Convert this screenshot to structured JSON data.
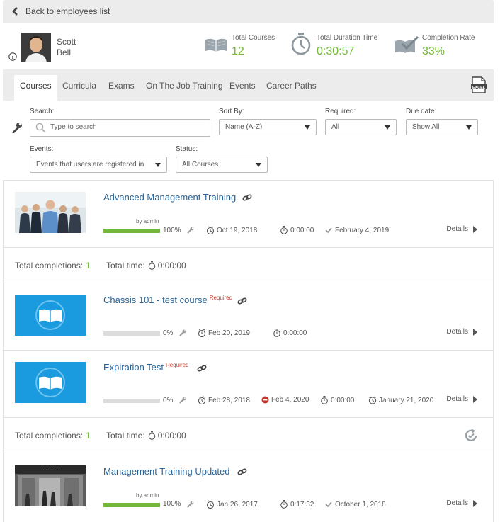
{
  "nav": {
    "back_label": "Back to employees list"
  },
  "user": {
    "first_name": "Scott",
    "last_name": "Bell"
  },
  "stats": {
    "total_courses": {
      "label": "Total Courses",
      "value": "12"
    },
    "total_duration": {
      "label": "Total Duration Time",
      "value": "0:30:57"
    },
    "completion_rate": {
      "label": "Completion Rate",
      "value": "33%"
    }
  },
  "tabs": [
    "Courses",
    "Curricula",
    "Exams",
    "On The Job Training",
    "Events",
    "Career Paths"
  ],
  "filters": {
    "search_label": "Search:",
    "search_placeholder": "Type to search",
    "sort_label": "Sort By:",
    "sort_value": "Name (A-Z)",
    "required_label": "Required:",
    "required_value": "All",
    "due_label": "Due date:",
    "due_value": "Show All",
    "events_label": "Events:",
    "events_value": "Events that users are registered in",
    "status_label": "Status:",
    "status_value": "All Courses"
  },
  "courses": [
    {
      "title": "Advanced Management Training",
      "required": "",
      "by": "by admin",
      "progress": "100%",
      "progress_fraction": 1.0,
      "start": "Oct 19, 2018",
      "expires": "",
      "time": "0:00:00",
      "completed": "February 4, 2019",
      "details": "Details"
    },
    {
      "title": "Chassis 101 - test course",
      "required": "Required",
      "by": "",
      "progress": "0%",
      "progress_fraction": 0.0,
      "start": "Feb 20, 2019",
      "expires": "",
      "time": "0:00:00",
      "completed": "",
      "details": "Details"
    },
    {
      "title": "Expiration Test",
      "required": "Required",
      "by": "",
      "progress": "0%",
      "progress_fraction": 0.0,
      "start": "Feb 28, 2018",
      "expires": "Feb 4, 2020",
      "time": "0:00:00",
      "due": "January 21, 2020",
      "details": "Details"
    },
    {
      "title": "Management Training Updated",
      "required": "",
      "by": "by admin",
      "progress": "100%",
      "progress_fraction": 1.0,
      "start": "Jan 26, 2017",
      "expires": "",
      "time": "0:17:32",
      "completed": "October 1, 2018",
      "details": "Details"
    }
  ],
  "totals": [
    {
      "completions_label": "Total completions:",
      "completions_value": "1",
      "time_label": "Total time:",
      "time_value": "0:00:00"
    },
    {
      "completions_label": "Total completions:",
      "completions_value": "1",
      "time_label": "Total time:",
      "time_value": "0:00:00"
    }
  ],
  "colors": {
    "accent_green": "#72b83a",
    "link_blue": "#2a6496",
    "required_red": "#c0392b",
    "thumb_blue": "#1a9be0"
  }
}
